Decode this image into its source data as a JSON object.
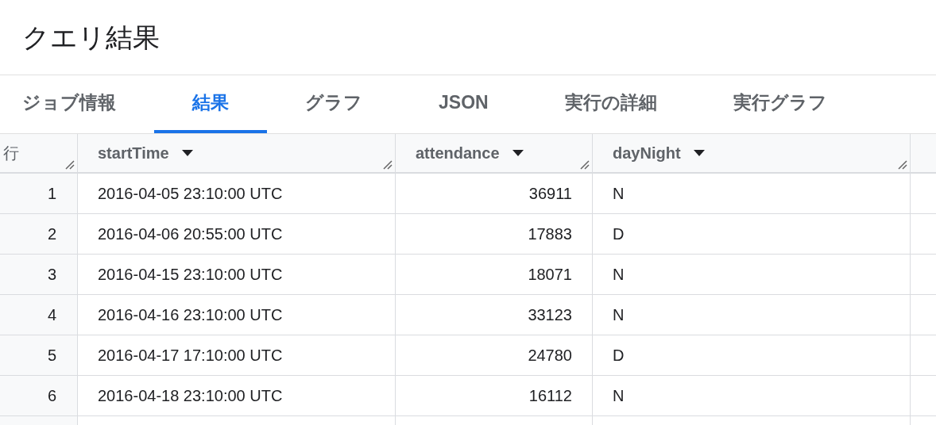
{
  "title": "クエリ結果",
  "tabs": [
    {
      "label": "ジョブ情報",
      "selected": false
    },
    {
      "label": "結果",
      "selected": true
    },
    {
      "label": "グラフ",
      "selected": false
    },
    {
      "label": "JSON",
      "selected": false
    },
    {
      "label": "実行の詳細",
      "selected": false
    },
    {
      "label": "実行グラフ",
      "selected": false
    }
  ],
  "table": {
    "row_header": "行",
    "columns": [
      {
        "label": "startTime",
        "kind": "text"
      },
      {
        "label": "attendance",
        "kind": "number"
      },
      {
        "label": "dayNight",
        "kind": "text"
      }
    ],
    "rows": [
      {
        "index": "1",
        "cells": [
          "2016-04-05 23:10:00 UTC",
          "36911",
          "N"
        ]
      },
      {
        "index": "2",
        "cells": [
          "2016-04-06 20:55:00 UTC",
          "17883",
          "D"
        ]
      },
      {
        "index": "3",
        "cells": [
          "2016-04-15 23:10:00 UTC",
          "18071",
          "N"
        ]
      },
      {
        "index": "4",
        "cells": [
          "2016-04-16 23:10:00 UTC",
          "33123",
          "N"
        ]
      },
      {
        "index": "5",
        "cells": [
          "2016-04-17 17:10:00 UTC",
          "24780",
          "D"
        ]
      },
      {
        "index": "6",
        "cells": [
          "2016-04-18 23:10:00 UTC",
          "16112",
          "N"
        ]
      }
    ]
  }
}
